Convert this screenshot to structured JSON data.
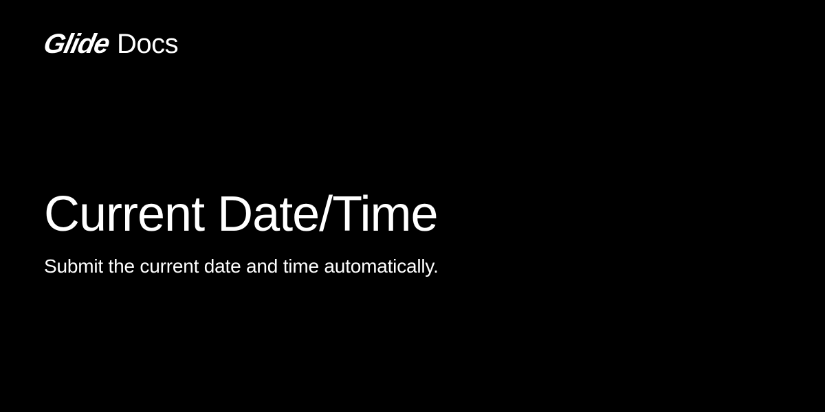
{
  "header": {
    "brand": "Glide",
    "suffix": "Docs"
  },
  "content": {
    "title": "Current Date/Time",
    "subtitle": "Submit the current date and time automatically."
  }
}
